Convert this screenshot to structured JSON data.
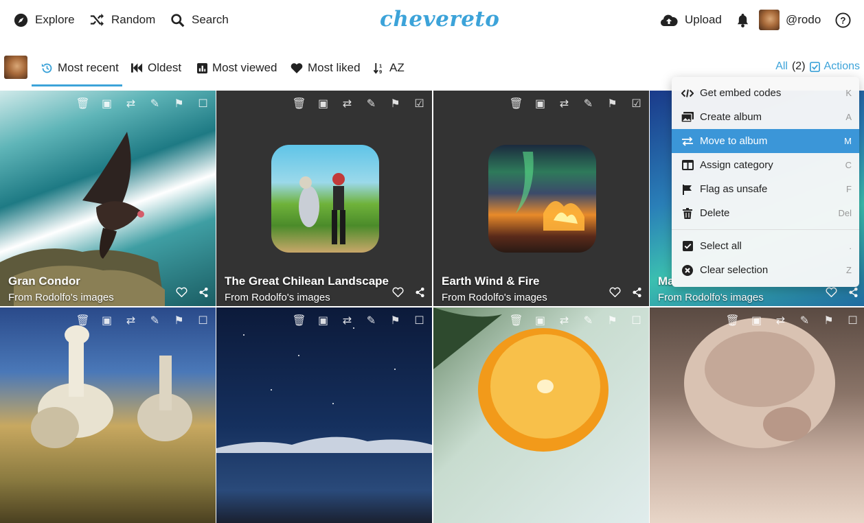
{
  "nav": {
    "explore": "Explore",
    "random": "Random",
    "search": "Search",
    "logo": "chevereto",
    "upload": "Upload",
    "username": "@rodo"
  },
  "sort": {
    "most_recent": "Most recent",
    "oldest": "Oldest",
    "most_viewed": "Most viewed",
    "most_liked": "Most liked",
    "az": "AZ",
    "all": "All",
    "count": "(2)",
    "actions": "Actions"
  },
  "tiles": [
    {
      "title": "Gran Condor",
      "sub": "From Rodolfo's images"
    },
    {
      "title": "The Great Chilean Landscape",
      "sub": "From Rodolfo's images"
    },
    {
      "title": "Earth Wind & Fire",
      "sub": "From Rodolfo's images"
    },
    {
      "title": "Ma",
      "sub": "From Rodolfo's images"
    }
  ],
  "menu": {
    "items": [
      {
        "label": "Get embed codes",
        "key": "K",
        "icon": "code-icon"
      },
      {
        "label": "Create album",
        "key": "A",
        "icon": "images-icon"
      },
      {
        "label": "Move to album",
        "key": "M",
        "icon": "exchange-icon"
      },
      {
        "label": "Assign category",
        "key": "C",
        "icon": "columns-icon"
      },
      {
        "label": "Flag as unsafe",
        "key": "F",
        "icon": "flag-icon"
      },
      {
        "label": "Delete",
        "key": "Del",
        "icon": "trash-icon"
      },
      {
        "label": "Select all",
        "key": ".",
        "icon": "check-square-icon"
      },
      {
        "label": "Clear selection",
        "key": "Z",
        "icon": "times-circle-icon"
      }
    ]
  },
  "colors": {
    "accent": "#3ca3d9",
    "highlight": "#3b96d8",
    "dark_tile": "#333333"
  }
}
